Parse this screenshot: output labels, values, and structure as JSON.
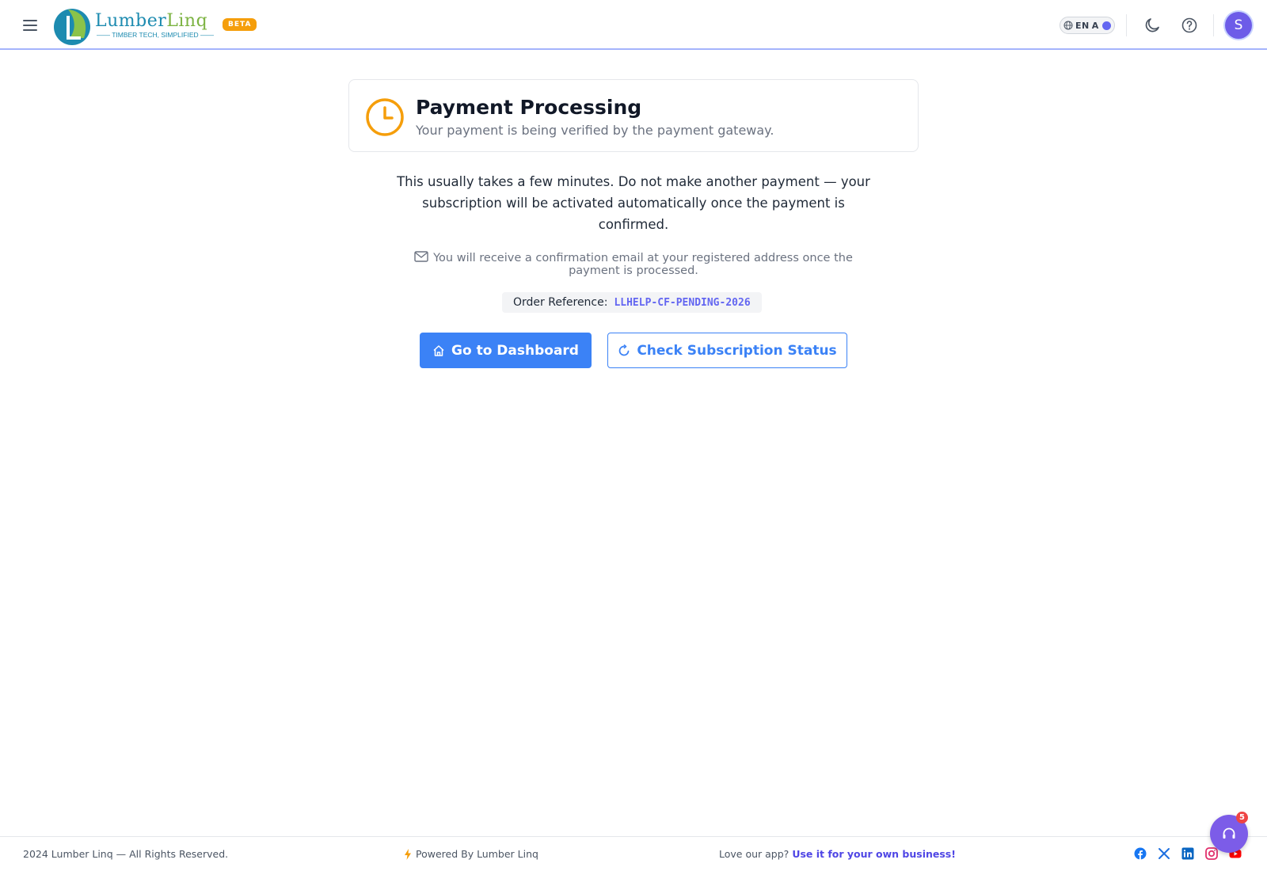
{
  "header": {
    "logo_name_part1": "Lumber",
    "logo_name_part2": "Linq",
    "logo_tagline": "—— TIMBER TECH, SIMPLIFIED ——",
    "beta_label": "BETA",
    "language_code": "EN",
    "language_script": "A",
    "avatar_initial": "S"
  },
  "status": {
    "title": "Payment Processing",
    "subtitle": "Your payment is being verified by the payment gateway.",
    "accent_color": "#f59e0b"
  },
  "message": "This usually takes a few minutes. Do not make another payment — your subscription will be activated automatically once the payment is confirmed.",
  "email_note": "You will receive a confirmation email at your registered address once the payment is processed.",
  "order": {
    "label": "Order Reference:",
    "code": "LLHELP-CF-PENDING-2026"
  },
  "actions": {
    "dashboard_label": "Go to Dashboard",
    "check_status_label": "Check Subscription Status"
  },
  "footer": {
    "copyright": "2024 Lumber Linq — All Rights Reserved.",
    "powered_by": "Powered By Lumber Linq",
    "love_text": "Love our app?",
    "love_link": "Use it for your own business!",
    "socials": [
      "facebook-icon",
      "x-icon",
      "linkedin-icon",
      "instagram-icon",
      "youtube-icon"
    ]
  },
  "support": {
    "badge_count": "5"
  },
  "colors": {
    "primary": "#3b82f6",
    "brand_blue": "#1d8bb0",
    "brand_green": "#7cb342",
    "avatar": "#6d5ce8"
  }
}
